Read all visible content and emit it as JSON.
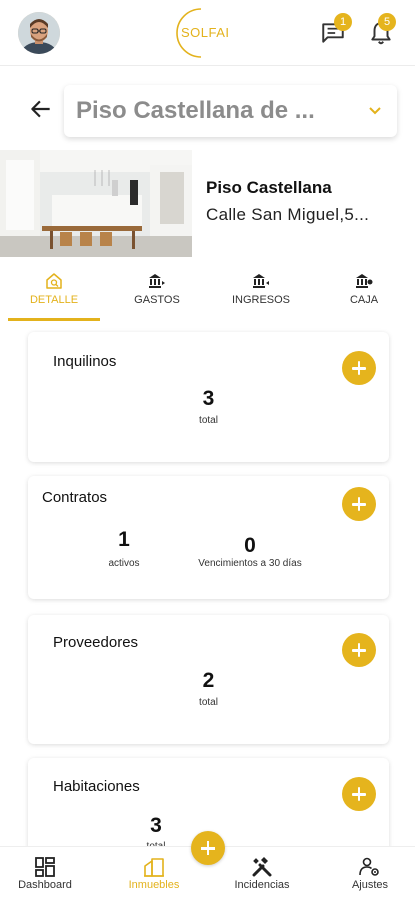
{
  "header": {
    "logo_text": "SOLFAI",
    "messages_badge": "1",
    "notifications_badge": "5",
    "accent_color": "#e3b21c"
  },
  "property_selector": {
    "selected": "Piso Castellana de ..."
  },
  "property": {
    "name": "Piso Castellana",
    "address": "Calle San Miguel,5..."
  },
  "tabs": [
    {
      "label": "DETALLE",
      "icon": "home-search-icon",
      "active": true
    },
    {
      "label": "GASTOS",
      "icon": "bank-out-icon",
      "active": false
    },
    {
      "label": "INGRESOS",
      "icon": "bank-in-icon",
      "active": false
    },
    {
      "label": "CAJA",
      "icon": "bank-transfer-icon",
      "active": false
    }
  ],
  "cards": {
    "inquilinos": {
      "title": "Inquilinos",
      "value": "3",
      "label": "total"
    },
    "contratos": {
      "title": "Contratos",
      "activos_value": "1",
      "activos_label": "activos",
      "vencimientos_value": "0",
      "vencimientos_label": "Vencimientos a 30 días"
    },
    "proveedores": {
      "title": "Proveedores",
      "value": "2",
      "label": "total"
    },
    "habitaciones": {
      "title": "Habitaciones",
      "value": "3",
      "label": "total"
    }
  },
  "bottom_nav": [
    {
      "label": "Dashboard",
      "icon": "dashboard-icon",
      "active": false
    },
    {
      "label": "Inmuebles",
      "icon": "building-icon",
      "active": true
    },
    {
      "label": "Incidencias",
      "icon": "tools-icon",
      "active": false
    },
    {
      "label": "Ajustes",
      "icon": "user-settings-icon",
      "active": false
    }
  ]
}
